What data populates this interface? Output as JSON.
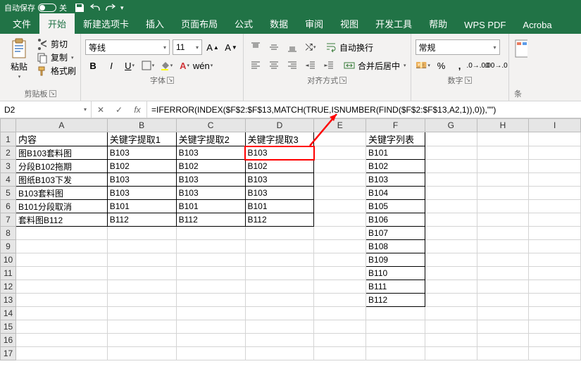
{
  "titlebar": {
    "autosave": "自动保存",
    "toggle_state": "关"
  },
  "tabs": {
    "file": "文件",
    "home": "开始",
    "newtab": "新建选项卡",
    "insert": "插入",
    "layout": "页面布局",
    "formulas": "公式",
    "data": "数据",
    "review": "审阅",
    "view": "视图",
    "dev": "开发工具",
    "help": "帮助",
    "wps": "WPS PDF",
    "acrobat": "Acroba"
  },
  "ribbon": {
    "clipboard": {
      "label": "剪贴板",
      "paste": "粘贴",
      "cut": "剪切",
      "copy": "复制",
      "format_painter": "格式刷"
    },
    "font": {
      "label": "字体",
      "name": "等线",
      "size": "11"
    },
    "align": {
      "label": "对齐方式",
      "wrap": "自动换行",
      "merge": "合并后居中"
    },
    "number": {
      "label": "数字",
      "format": "常规"
    },
    "cond": {
      "label": "条"
    }
  },
  "name_box": "D2",
  "formula": "=IFERROR(INDEX($F$2:$F$13,MATCH(TRUE,ISNUMBER(FIND($F$2:$F$13,A2,1)),0)),\"\")",
  "headers": [
    "A",
    "B",
    "C",
    "D",
    "E",
    "F",
    "G",
    "H",
    "I"
  ],
  "rows": [
    {
      "r": 1,
      "A": "内容",
      "B": "关键字提取1",
      "C": "关键字提取2",
      "D": "关键字提取3",
      "F": "关键字列表"
    },
    {
      "r": 2,
      "A": "图B103套料图",
      "B": "B103",
      "C": "B103",
      "D": "B103",
      "F": "B101"
    },
    {
      "r": 3,
      "A": "分段B102拖期",
      "B": "B102",
      "C": "B102",
      "D": "B102",
      "F": "B102"
    },
    {
      "r": 4,
      "A": "图纸B103下发",
      "B": "B103",
      "C": "B103",
      "D": "B103",
      "F": "B103"
    },
    {
      "r": 5,
      "A": "B103套料图",
      "B": "B103",
      "C": "B103",
      "D": "B103",
      "F": "B104"
    },
    {
      "r": 6,
      "A": "B101分段取消",
      "B": "B101",
      "C": "B101",
      "D": "B101",
      "F": "B105"
    },
    {
      "r": 7,
      "A": "套料图B112",
      "B": "B112",
      "C": "B112",
      "D": "B112",
      "F": "B106"
    },
    {
      "r": 8,
      "F": "B107"
    },
    {
      "r": 9,
      "F": "B108"
    },
    {
      "r": 10,
      "F": "B109"
    },
    {
      "r": 11,
      "F": "B110"
    },
    {
      "r": 12,
      "F": "B111"
    },
    {
      "r": 13,
      "F": "B112"
    },
    {
      "r": 14
    },
    {
      "r": 15
    },
    {
      "r": 16
    },
    {
      "r": 17
    }
  ],
  "chart_data": {
    "type": "table",
    "title": "关键字提取",
    "columns": [
      "内容",
      "关键字提取1",
      "关键字提取2",
      "关键字提取3",
      "关键字列表"
    ],
    "data_columns": {
      "内容": [
        "图B103套料图",
        "分段B102拖期",
        "图纸B103下发",
        "B103套料图",
        "B101分段取消",
        "套料图B112"
      ],
      "关键字提取1": [
        "B103",
        "B102",
        "B103",
        "B103",
        "B101",
        "B112"
      ],
      "关键字提取2": [
        "B103",
        "B102",
        "B103",
        "B103",
        "B101",
        "B112"
      ],
      "关键字提取3": [
        "B103",
        "B102",
        "B103",
        "B103",
        "B101",
        "B112"
      ],
      "关键字列表": [
        "B101",
        "B102",
        "B103",
        "B104",
        "B105",
        "B106",
        "B107",
        "B108",
        "B109",
        "B110",
        "B111",
        "B112"
      ]
    }
  }
}
